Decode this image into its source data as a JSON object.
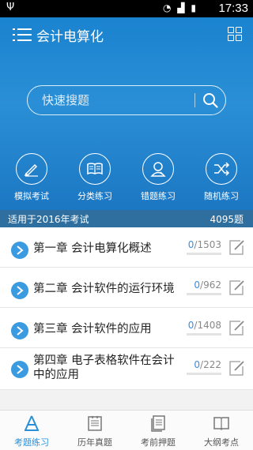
{
  "status_bar": {
    "time": "17:33"
  },
  "app": {
    "title": "会计电算化"
  },
  "search": {
    "placeholder": "快速搜题"
  },
  "quick_actions": [
    {
      "label": "模拟考试",
      "icon": "pencil-icon"
    },
    {
      "label": "分类练习",
      "icon": "book-icon"
    },
    {
      "label": "错题练习",
      "icon": "user-icon"
    },
    {
      "label": "随机练习",
      "icon": "shuffle-icon"
    }
  ],
  "banner": {
    "left": "适用于2016年考试",
    "right": "4095题"
  },
  "chapters": [
    {
      "title": "第一章 会计电算化概述",
      "done": "0",
      "total": "/1503"
    },
    {
      "title": "第二章 会计软件的运行环境",
      "done": "0",
      "total": "/962"
    },
    {
      "title": "第三章 会计软件的应用",
      "done": "0",
      "total": "/1408"
    },
    {
      "title_line1": "第四章 电子表格软件在会计",
      "title_line2": "中的应用",
      "done": "0",
      "total": "/222"
    }
  ],
  "tabs": [
    {
      "label": "考题练习",
      "active": true
    },
    {
      "label": "历年真题",
      "active": false
    },
    {
      "label": "考前押题",
      "active": false
    },
    {
      "label": "大纲考点",
      "active": false
    }
  ],
  "colors": {
    "primary": "#2a8fd6",
    "banner": "#2f6f9f",
    "accent": "#3b9be0"
  }
}
